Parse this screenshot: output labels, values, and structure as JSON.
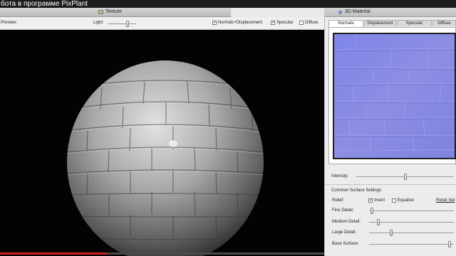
{
  "window": {
    "title": "бота в программе PixPlant"
  },
  "left_panel": {
    "tab_label": "Texture"
  },
  "toolbar": {
    "preview_label": "Preview:",
    "light_label": "Light:",
    "light_level": 0.7,
    "normals_label": "Normals+Displacement",
    "normals_checked": true,
    "specular_label": "Specular",
    "specular_checked": true,
    "diffuse_label": "Diffuse",
    "diffuse_checked": false
  },
  "right_panel": {
    "header_label": "3D Material",
    "tabs": [
      {
        "label": "Normals",
        "active": true
      },
      {
        "label": "Displacement",
        "active": false
      },
      {
        "label": "Specular",
        "active": false
      },
      {
        "label": "Diffuse",
        "active": false
      }
    ],
    "intensity_label": "Intensity:",
    "intensity_level": 0.5,
    "section_title": "Common Surface Settings",
    "relief_label": "Relief:",
    "invert_label": "Invert",
    "invert_checked": true,
    "equalize_label": "Equalize",
    "equalize_checked": false,
    "reset_label": "Reset Set",
    "sliders": [
      {
        "label": "Fine Detail:",
        "level": 0.03
      },
      {
        "label": "Medium Detail:",
        "level": 0.11
      },
      {
        "label": "Large Detail:",
        "level": 0.26
      },
      {
        "label": "Base Surface:",
        "level": 0.95
      }
    ]
  },
  "video": {
    "progress": 0.33
  },
  "colors": {
    "normal_map": "#8a8ae0",
    "progress": "#d42020",
    "background": "#030303"
  }
}
